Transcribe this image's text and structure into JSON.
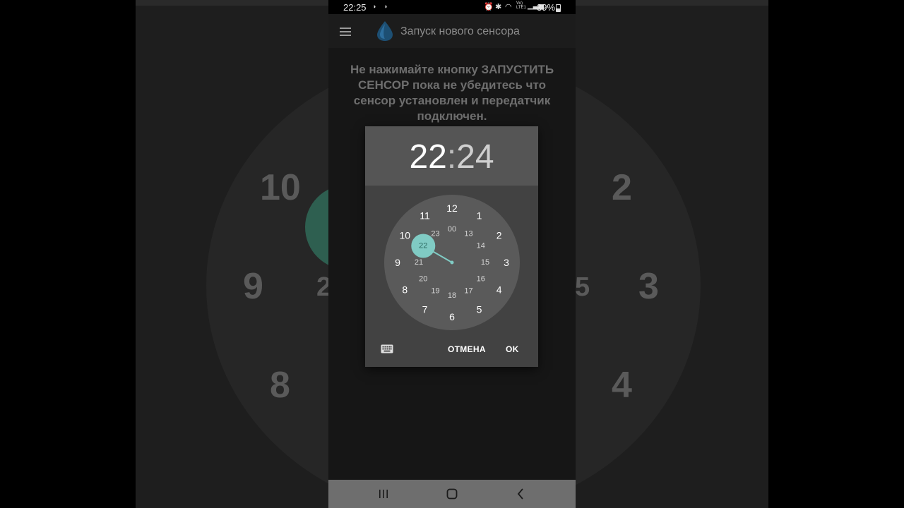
{
  "background": {
    "numbers": [
      "10",
      "9",
      "8",
      "2",
      "3",
      "4",
      "2",
      "5"
    ]
  },
  "status_bar": {
    "time": "22:25",
    "network_label_top": "Vo)",
    "network_label_bottom": "LTE1",
    "battery": "39%"
  },
  "app_bar": {
    "title": "Запуск нового сенсора",
    "menu_icon": "hamburger-menu-icon",
    "app_icon": "water-drop-icon"
  },
  "main": {
    "warning": "Не нажимайте кнопку ЗАПУСТИТЬ СЕНСОР пока не убедитесь что сенсор установлен и передатчик подключен."
  },
  "time_picker": {
    "hour": "22",
    "separator": ":",
    "minute": "24",
    "selected_hour": "22",
    "outer_hours": [
      "12",
      "1",
      "2",
      "3",
      "4",
      "5",
      "6",
      "7",
      "8",
      "9",
      "10",
      "11"
    ],
    "inner_hours": [
      "00",
      "13",
      "14",
      "15",
      "16",
      "17",
      "18",
      "19",
      "20",
      "21",
      "22",
      "23"
    ],
    "cancel_label": "ОТМЕНА",
    "ok_label": "OK",
    "keyboard_icon": "keyboard-icon",
    "accent_color": "#80cbc4",
    "selected_text_color": "#2b6b62"
  },
  "nav_bar": {
    "recents_icon": "recents-icon",
    "home_icon": "home-icon",
    "back_icon": "back-icon"
  }
}
